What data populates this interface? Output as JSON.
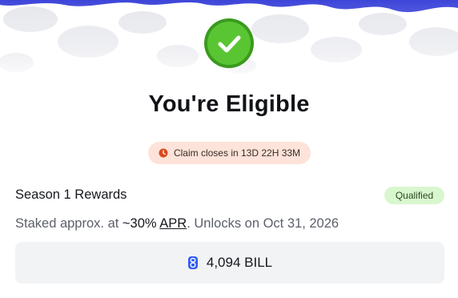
{
  "title": "You're Eligible",
  "claim_pill": {
    "text": "Claim closes in 13D 22H 33M",
    "icon": "clock-icon",
    "color": "#d9481f"
  },
  "rewards": {
    "title": "Season 1 Rewards",
    "badge": "Qualified",
    "desc_prefix": "Staked approx. at ",
    "apr_value": "~30%",
    "apr_link": "APR",
    "desc_suffix": ". Unlocks on Oct 31, 2026"
  },
  "amount": {
    "value": "4,094 BILL",
    "icon": "bill-token-icon",
    "color": "#2f5cf0"
  },
  "colors": {
    "success": "#5ac532",
    "pattern_accent": "#3e46d9"
  }
}
